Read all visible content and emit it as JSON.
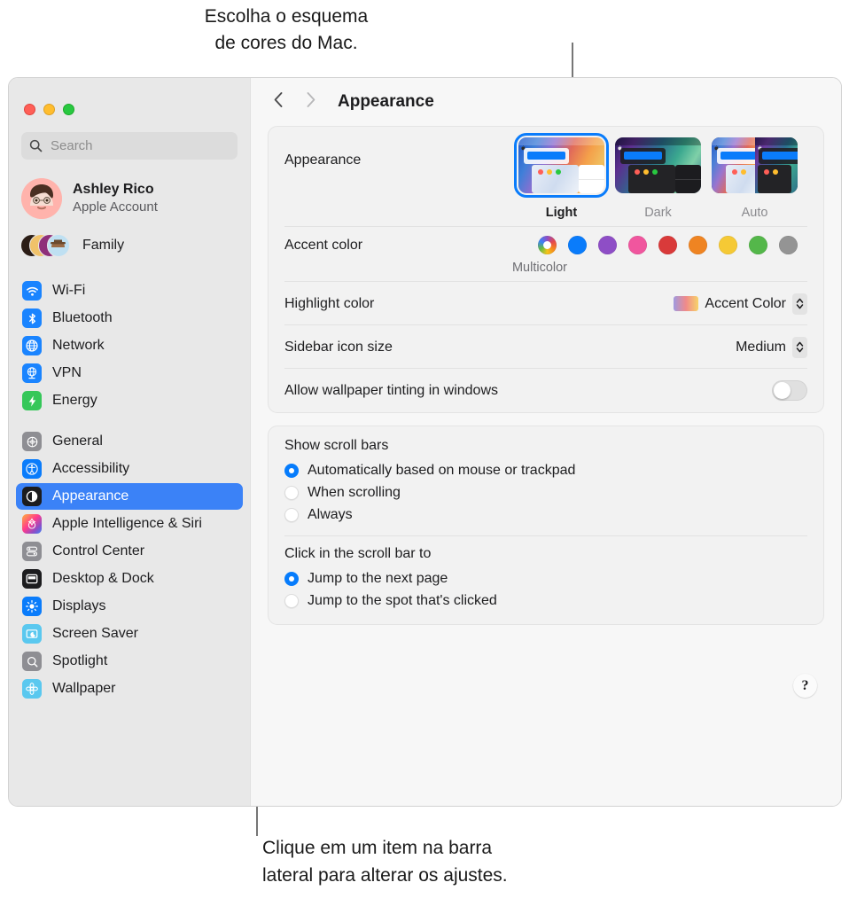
{
  "callouts": {
    "top": [
      "Escolha o esquema",
      "de cores do Mac."
    ],
    "bottom": [
      "Clique em um item na barra",
      "lateral para alterar os ajustes."
    ]
  },
  "sidebar": {
    "search": {
      "placeholder": "Search",
      "value": ""
    },
    "account": {
      "name": "Ashley Rico",
      "subtitle": "Apple Account"
    },
    "family": {
      "label": "Family"
    },
    "groups": [
      {
        "items": [
          {
            "label": "Wi-Fi",
            "icon": "wifi-icon",
            "color": "#1a84ff",
            "selected": false
          },
          {
            "label": "Bluetooth",
            "icon": "bluetooth-icon",
            "color": "#1a84ff",
            "selected": false
          },
          {
            "label": "Network",
            "icon": "globe-icon",
            "color": "#1a84ff",
            "selected": false
          },
          {
            "label": "VPN",
            "icon": "vpn-globe-icon",
            "color": "#1a84ff",
            "selected": false
          },
          {
            "label": "Energy",
            "icon": "bolt-icon",
            "color": "#35c759",
            "selected": false
          }
        ]
      },
      {
        "items": [
          {
            "label": "General",
            "icon": "gear-icon",
            "color": "#8e8e93",
            "selected": false
          },
          {
            "label": "Accessibility",
            "icon": "accessibility-icon",
            "color": "#0a7cfb",
            "selected": false
          },
          {
            "label": "Appearance",
            "icon": "appearance-contrast-icon",
            "color": "#1c1c1e",
            "selected": true
          },
          {
            "label": "Apple Intelligence & Siri",
            "icon": "siri-icon",
            "color": "#ff3b8b",
            "selected": false
          },
          {
            "label": "Control Center",
            "icon": "control-center-icon",
            "color": "#8e8e93",
            "selected": false
          },
          {
            "label": "Desktop & Dock",
            "icon": "desktop-dock-icon",
            "color": "#1c1c1e",
            "selected": false
          },
          {
            "label": "Displays",
            "icon": "displays-brightness-icon",
            "color": "#0a7cfb",
            "selected": false
          },
          {
            "label": "Screen Saver",
            "icon": "screen-saver-icon",
            "color": "#5ac8ef",
            "selected": false
          },
          {
            "label": "Spotlight",
            "icon": "spotlight-search-icon",
            "color": "#8e8e93",
            "selected": false
          },
          {
            "label": "Wallpaper",
            "icon": "wallpaper-flower-icon",
            "color": "#5ac8ef",
            "selected": false
          }
        ]
      }
    ]
  },
  "toolbar": {
    "back_icon": "chevron-left-icon",
    "forward_icon": "chevron-right-icon",
    "title": "Appearance"
  },
  "main": {
    "appearance": {
      "label": "Appearance",
      "options": [
        {
          "label": "Light",
          "selected": true
        },
        {
          "label": "Dark",
          "selected": false
        },
        {
          "label": "Auto",
          "selected": false
        }
      ]
    },
    "accent_color": {
      "label": "Accent color",
      "selected_name": "Multicolor",
      "swatches": [
        {
          "name": "Multicolor",
          "color": "multicolor",
          "selected": true
        },
        {
          "name": "Blue",
          "color": "#0a7cfb",
          "selected": false
        },
        {
          "name": "Purple",
          "color": "#8e4ec6",
          "selected": false
        },
        {
          "name": "Pink",
          "color": "#f0569e",
          "selected": false
        },
        {
          "name": "Red",
          "color": "#d93a3a",
          "selected": false
        },
        {
          "name": "Orange",
          "color": "#ef8422",
          "selected": false
        },
        {
          "name": "Yellow",
          "color": "#f5c935",
          "selected": false
        },
        {
          "name": "Green",
          "color": "#54b74a",
          "selected": false
        },
        {
          "name": "Graphite",
          "color": "#949494",
          "selected": false
        }
      ]
    },
    "highlight_color": {
      "label": "Highlight color",
      "value": "Accent Color"
    },
    "sidebar_icon_size": {
      "label": "Sidebar icon size",
      "value": "Medium"
    },
    "wallpaper_tinting": {
      "label": "Allow wallpaper tinting in windows",
      "on": false
    },
    "scroll_bars": {
      "title": "Show scroll bars",
      "options": [
        {
          "label": "Automatically based on mouse or trackpad",
          "selected": true
        },
        {
          "label": "When scrolling",
          "selected": false
        },
        {
          "label": "Always",
          "selected": false
        }
      ]
    },
    "scroll_click": {
      "title": "Click in the scroll bar to",
      "options": [
        {
          "label": "Jump to the next page",
          "selected": true
        },
        {
          "label": "Jump to the spot that's clicked",
          "selected": false
        }
      ]
    },
    "help_button": "?"
  }
}
